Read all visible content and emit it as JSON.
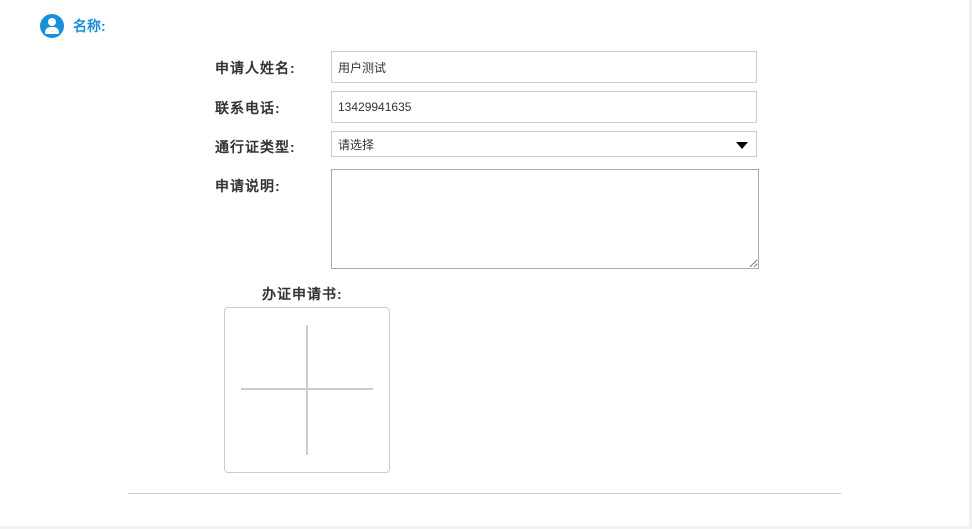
{
  "section": {
    "title": "名称:",
    "icon": "user-circle-icon",
    "accent": "#1a8fd8"
  },
  "form": {
    "name_label": "申请人姓名:",
    "name_value": "用户测试",
    "phone_label": "联系电话:",
    "phone_value": "13429941635",
    "type_label": "通行证类型:",
    "type_value": "请选择",
    "desc_label": "申请说明:",
    "desc_value": "",
    "upload_label": "办证申请书:"
  }
}
